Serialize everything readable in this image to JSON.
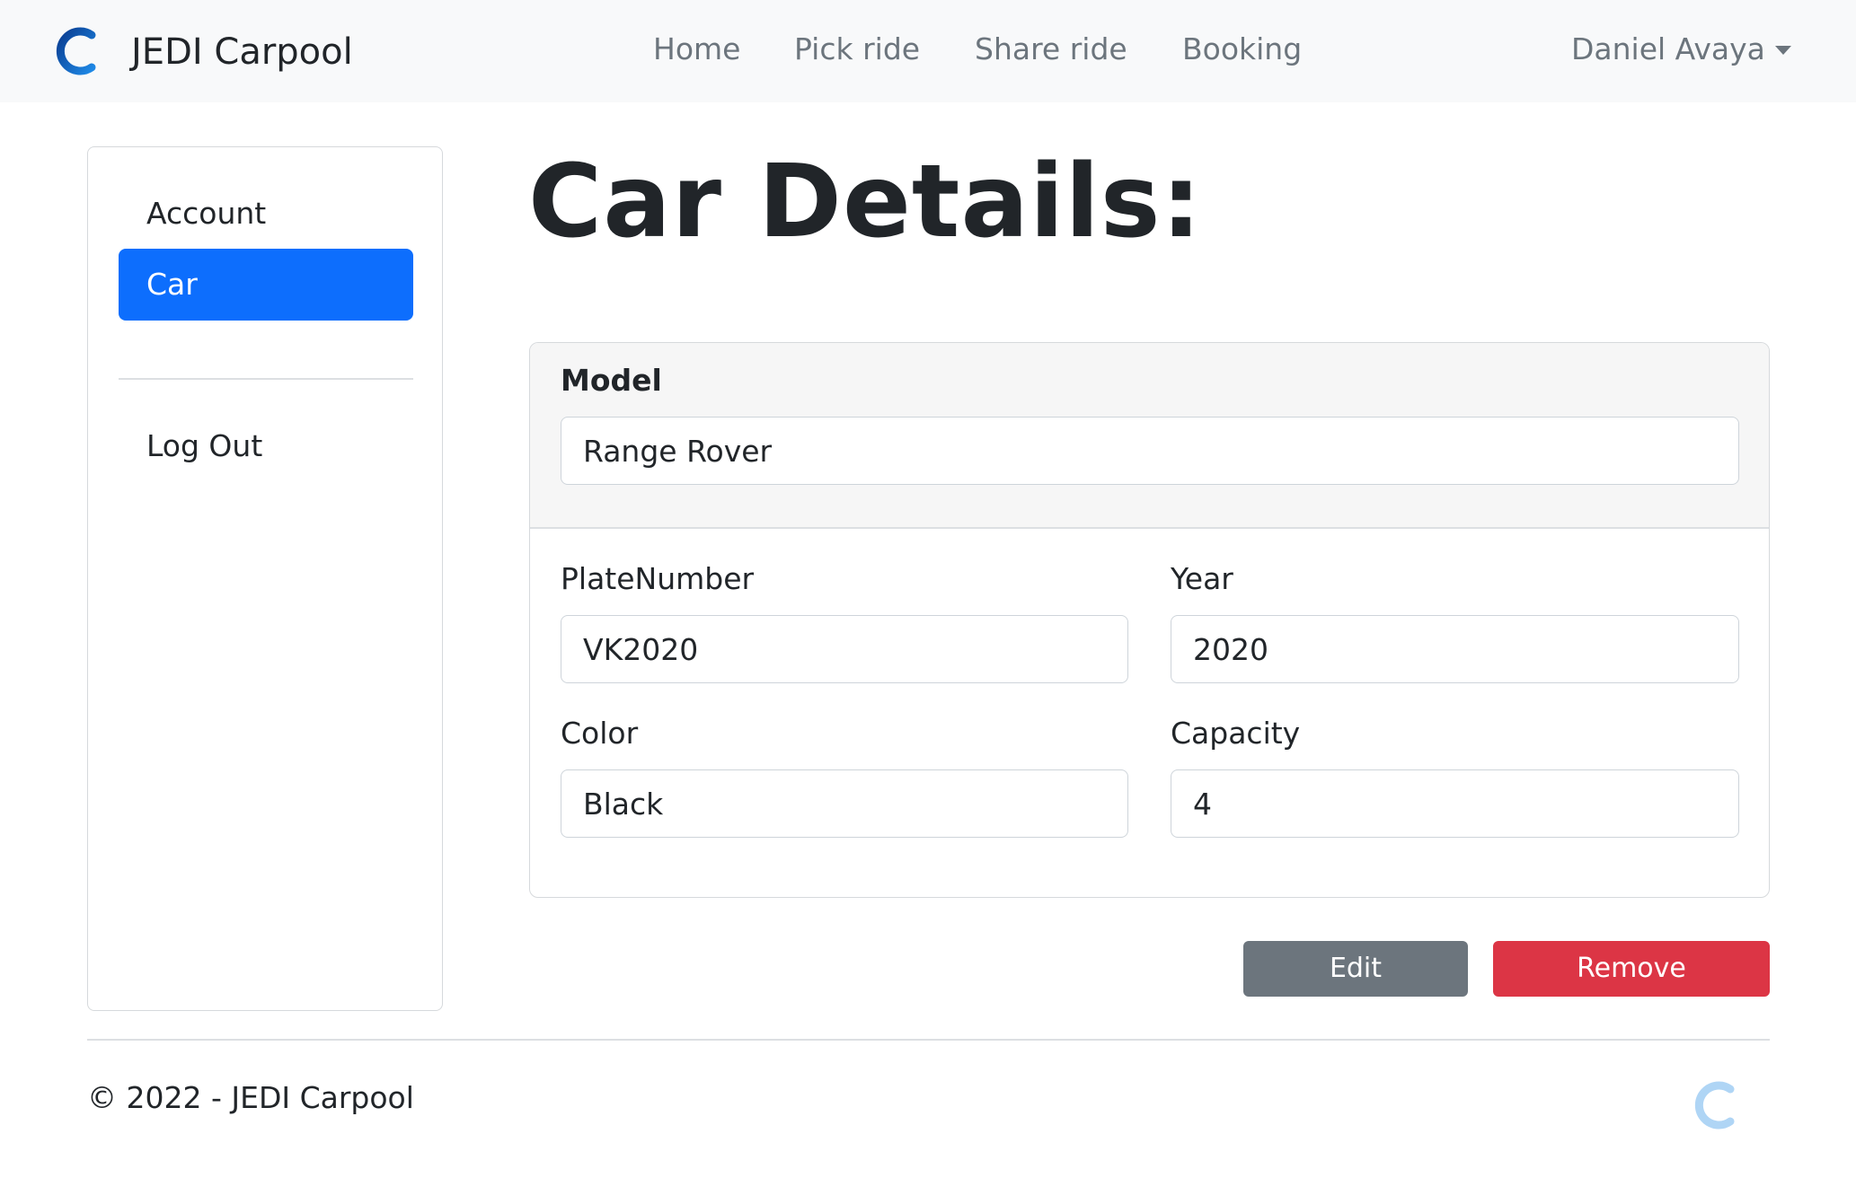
{
  "brand": {
    "name": "JEDI Carpool",
    "logo_icon": "carpool-c-logo-icon",
    "logo_color": "#0d4bb5"
  },
  "nav": {
    "links": [
      "Home",
      "Pick ride",
      "Share ride",
      "Booking"
    ],
    "user_name": "Daniel Avaya"
  },
  "sidebar": {
    "items": [
      {
        "label": "Account",
        "active": false
      },
      {
        "label": "Car",
        "active": true
      }
    ],
    "logout_label": "Log Out"
  },
  "main": {
    "title": "Car Details:",
    "model": {
      "label": "Model",
      "value": "Range Rover"
    },
    "plate": {
      "label": "PlateNumber",
      "value": "VK2020"
    },
    "year": {
      "label": "Year",
      "value": "2020"
    },
    "color": {
      "label": "Color",
      "value": "Black"
    },
    "capacity": {
      "label": "Capacity",
      "value": "4"
    }
  },
  "actions": {
    "edit_label": "Edit",
    "remove_label": "Remove"
  },
  "footer": {
    "text": "© 2022 - JEDI Carpool"
  },
  "colors": {
    "primary": "#0d6efd",
    "secondary": "#6c757d",
    "danger": "#dc3545",
    "navbar_bg": "#f8f9fa"
  }
}
